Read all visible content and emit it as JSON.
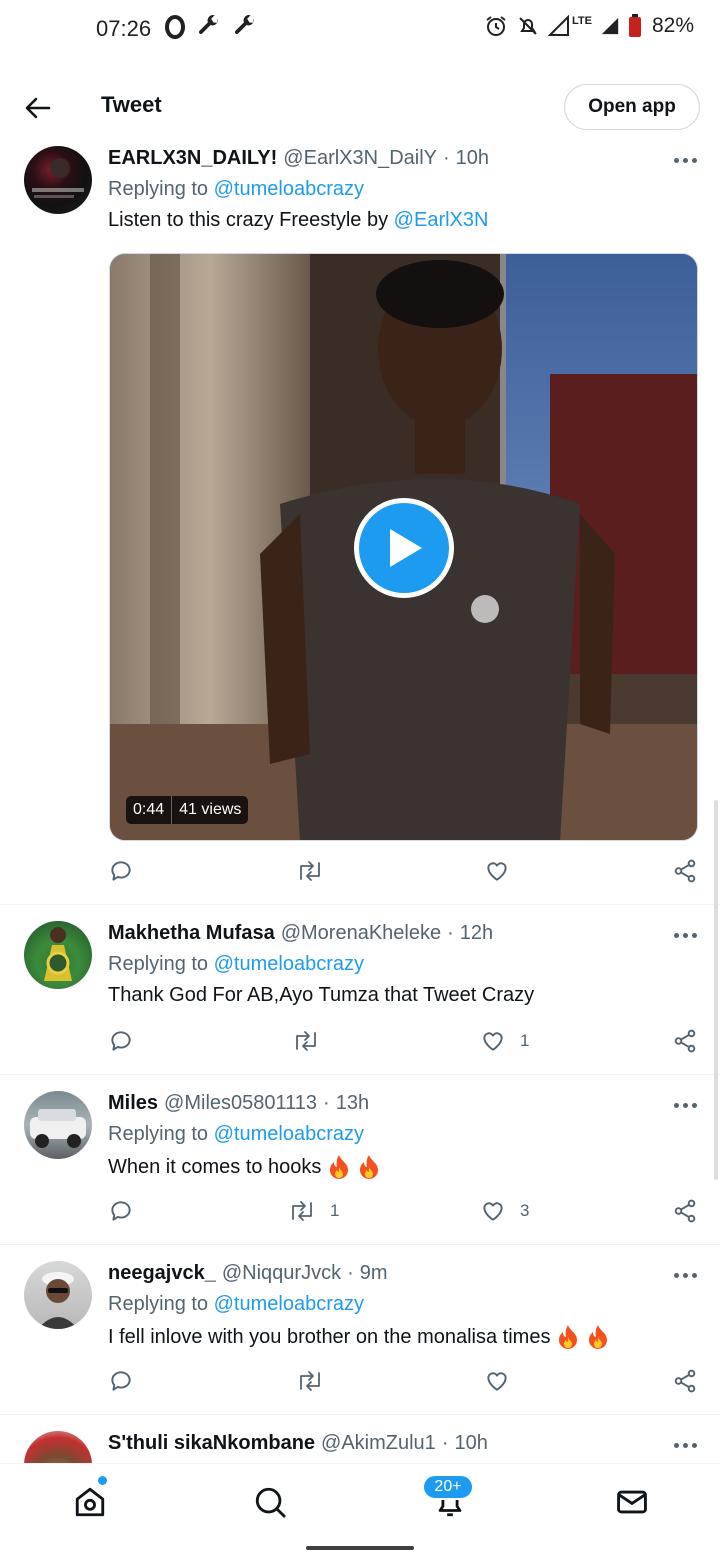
{
  "status_bar": {
    "time": "07:26",
    "network": "LTE",
    "battery": "82%",
    "icons": [
      "opera-icon",
      "wrench-icon",
      "wrench-icon",
      "alarm-icon",
      "mute-icon",
      "signal-icon",
      "signal-icon",
      "battery-icon"
    ]
  },
  "header": {
    "title": "Tweet",
    "open_app": "Open app"
  },
  "tweets": [
    {
      "name": "EARLX3N_DAILY!",
      "handle": "@EarlX3N_DailY",
      "time": "10h",
      "replying_prefix": "Replying to",
      "replying_to": "@tumeloabcrazy",
      "text": "Listen to this crazy Freestyle by",
      "text_link": "@EarlX3N",
      "video": {
        "duration": "0:44",
        "views": "41 views"
      },
      "retweets": "",
      "likes": ""
    },
    {
      "name": "Makhetha Mufasa",
      "handle": "@MorenaKheleke",
      "time": "12h",
      "replying_prefix": "Replying to",
      "replying_to": "@tumeloabcrazy",
      "text": "Thank God For AB,Ayo Tumza that Tweet Crazy",
      "retweets": "",
      "likes": "1"
    },
    {
      "name": "Miles",
      "handle": "@Miles05801113",
      "time": "13h",
      "replying_prefix": "Replying to",
      "replying_to": "@tumeloabcrazy",
      "text": "When it comes to hooks",
      "retweets": "1",
      "likes": "3"
    },
    {
      "name": "neegajvck_",
      "handle": "@NiqqurJvck",
      "time": "9m",
      "replying_prefix": "Replying to",
      "replying_to": "@tumeloabcrazy",
      "text": "I fell inlove with you brother on the monalisa times",
      "retweets": "",
      "likes": ""
    },
    {
      "name": "S'thuli sikaNkombane",
      "handle": "@AkimZulu1",
      "time": "10h"
    }
  ],
  "bottom_nav": {
    "notifications_badge": "20+",
    "items": [
      "home-icon",
      "search-icon",
      "bell-icon",
      "mail-icon"
    ]
  },
  "colors": {
    "accent": "#1d9bf0",
    "text_primary": "#0f1419",
    "text_secondary": "#536471"
  }
}
